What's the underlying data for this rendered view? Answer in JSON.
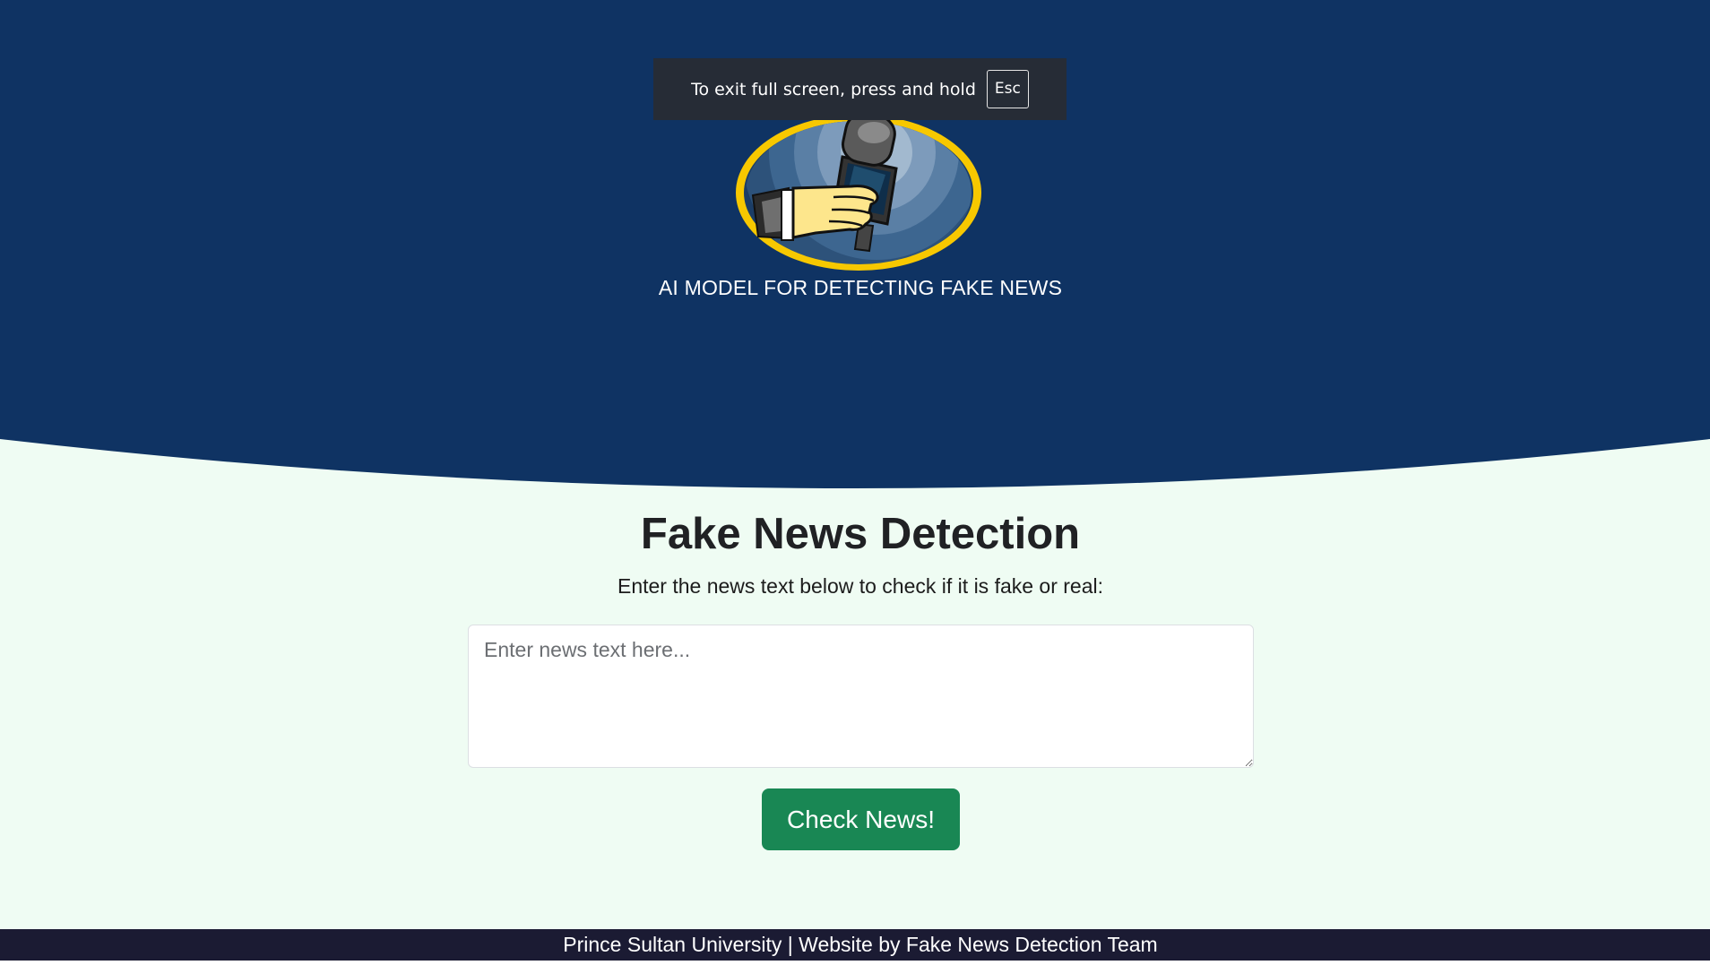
{
  "fullscreen_notice": {
    "message": "To exit full screen, press and hold",
    "key": "Esc"
  },
  "header": {
    "tagline": "AI MODEL FOR DETECTING FAKE NEWS",
    "logo_icon": "reporter-microphone-logo",
    "background_color": "#0f3363"
  },
  "main": {
    "title": "Fake News Detection",
    "instruction": "Enter the news text below to check if it is fake or real:",
    "input_placeholder": "Enter news text here...",
    "input_value": "",
    "button_label": "Check News!",
    "button_color": "#198754",
    "background_color": "#effcf3"
  },
  "footer": {
    "text": "Prince Sultan University | Website by Fake News Detection Team",
    "background_color": "#1b1b33"
  }
}
